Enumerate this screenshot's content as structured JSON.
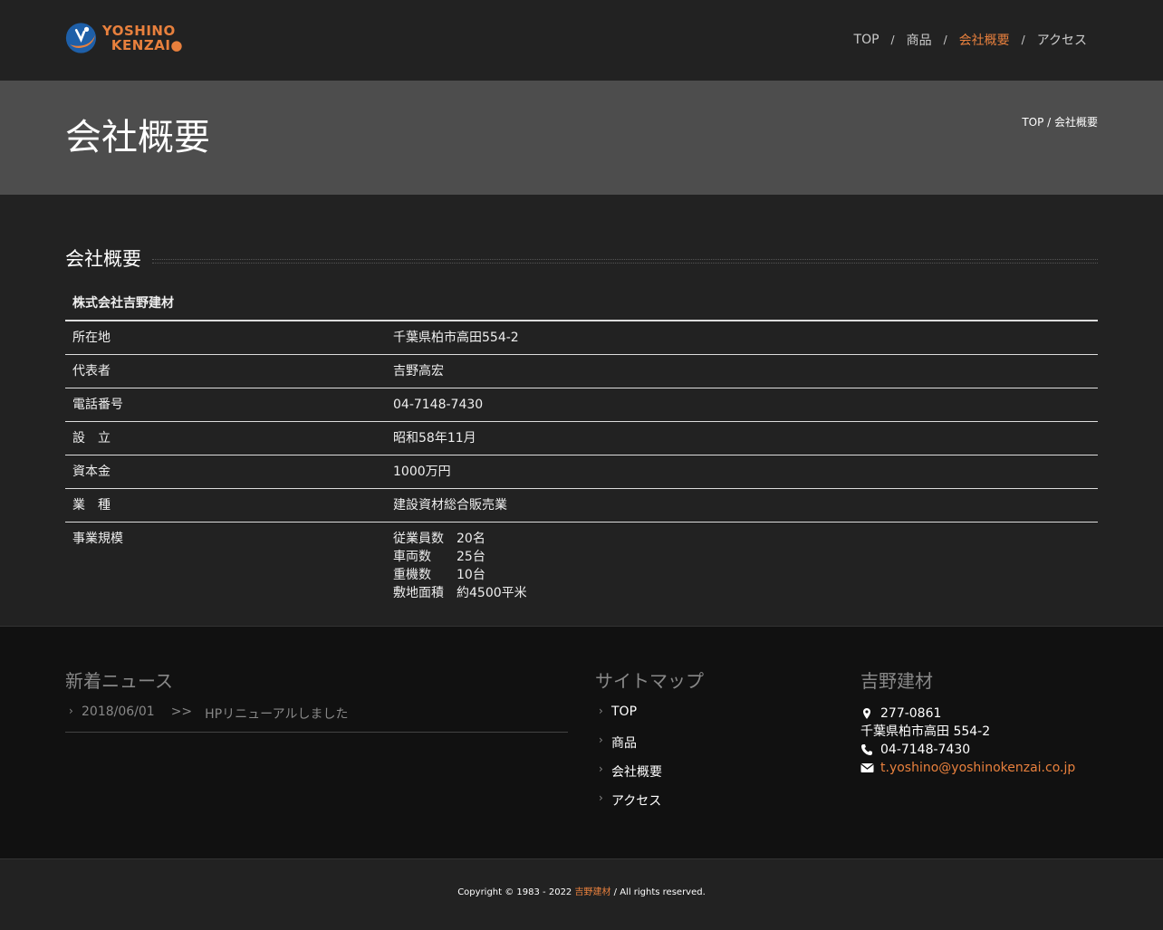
{
  "header": {
    "logo_line1": "YOSHINO",
    "logo_line2": "KENZAI",
    "nav": [
      {
        "label": "TOP"
      },
      {
        "label": "商品"
      },
      {
        "label": "会社概要",
        "active": true
      },
      {
        "label": "アクセス"
      }
    ],
    "separator": "/"
  },
  "titlebar": {
    "title": "会社概要",
    "breadcrumb": "TOP / 会社概要"
  },
  "main": {
    "section_title": "会社概要",
    "table_header": "株式会社吉野建材",
    "rows": [
      {
        "key": "所在地",
        "value": "千葉県柏市高田554-2"
      },
      {
        "key": "代表者",
        "value": "吉野高宏"
      },
      {
        "key": "電話番号",
        "value": "04-7148-7430"
      },
      {
        "key": "設　立",
        "value": "昭和58年11月"
      },
      {
        "key": "資本金",
        "value": "1000万円"
      },
      {
        "key": "業　種",
        "value": "建設資材総合販売業"
      }
    ],
    "scale": {
      "key": "事業規模",
      "items": [
        {
          "label": "従業員数",
          "value": "20名"
        },
        {
          "label": "車両数",
          "value": "25台"
        },
        {
          "label": "重機数",
          "value": "10台"
        },
        {
          "label": "敷地面積",
          "value": "約4500平米"
        }
      ]
    }
  },
  "footer": {
    "news_title": "新着ニュース",
    "news": {
      "date": "2018/06/01",
      "arrow": ">>",
      "text": "HPリニューアルしました"
    },
    "sitemap_title": "サイトマップ",
    "sitemap": [
      "TOP",
      "商品",
      "会社概要",
      "アクセス"
    ],
    "company_title": "吉野建材",
    "postal": "277-0861",
    "address": "千葉県柏市高田 554-2",
    "phone": "04-7148-7430",
    "email": "t.yoshino@yoshinokenzai.co.jp",
    "chevron": "›"
  },
  "bottom": {
    "copyright_prefix": "Copyright © 1983 - 2022 ",
    "copyright_link": "吉野建材",
    "copyright_suffix": " / All rights reserved."
  },
  "colors": {
    "accent": "#e8803d",
    "header_bg": "#222222",
    "titlebar_bg": "#4d4d4d",
    "footer_bg": "#111111"
  }
}
